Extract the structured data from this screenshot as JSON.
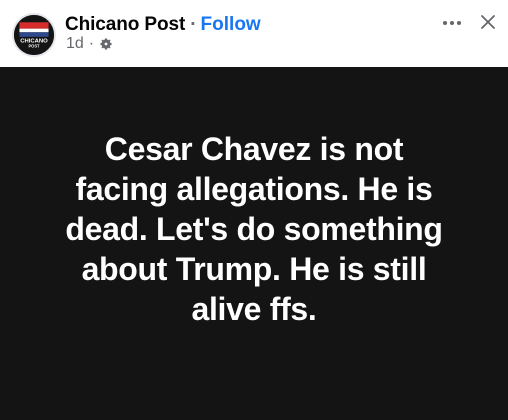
{
  "post": {
    "page_name": "Chicano Post",
    "separator": "·",
    "follow_label": "Follow",
    "time_ago": "1d",
    "meta_separator": "·",
    "audience_icon": "gear-icon",
    "text_lines": [
      "Cesar Chavez is not",
      "facing allegations. He is",
      "dead. Let's do something",
      "about Trump. He is still",
      "alive ffs."
    ],
    "avatar_text": [
      "CHICANO",
      "POST"
    ]
  },
  "colors": {
    "follow": "#1877f2",
    "post_background": "#141414",
    "post_text": "#ffffff",
    "meta": "#65676b"
  },
  "icons": {
    "more": "more-horizontal-icon",
    "close": "close-icon"
  }
}
